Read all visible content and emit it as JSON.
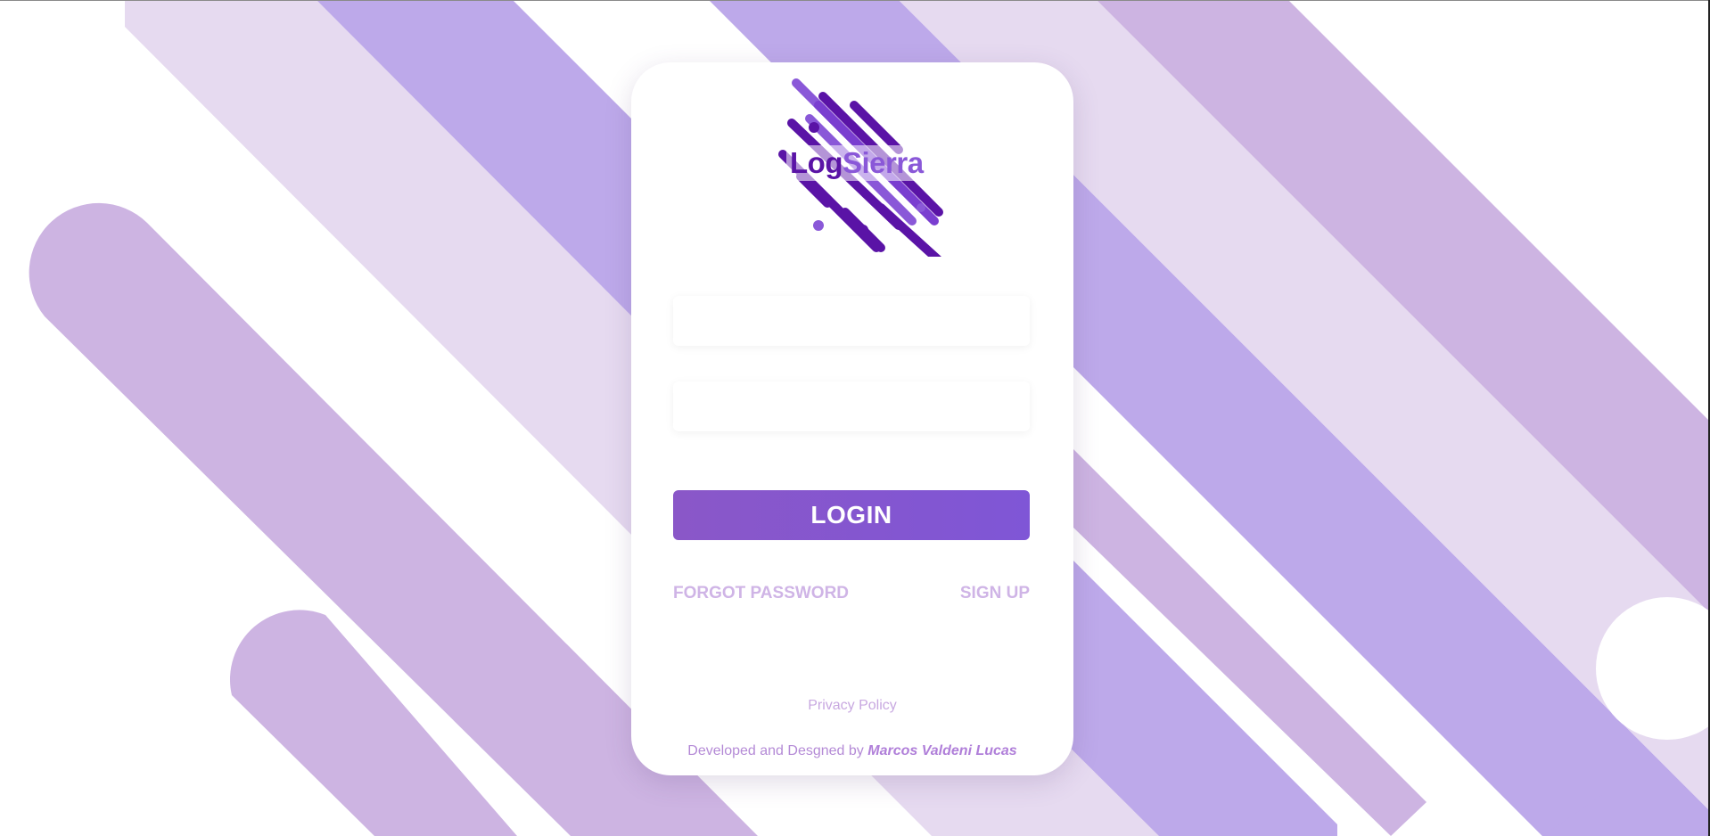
{
  "app": {
    "brand_part1": "Log",
    "brand_part2": "Sierra"
  },
  "form": {
    "username_value": "",
    "password_value": "",
    "login_label": "LOGIN"
  },
  "links": {
    "forgot_password": "FORGOT PASSWORD",
    "sign_up": "SIGN UP",
    "privacy_policy": "Privacy Policy"
  },
  "footer": {
    "credit_prefix": "Developed and Desgned by",
    "credit_author": "Marcos Valdeni Lucas"
  },
  "colors": {
    "stripe_lavender_light": "#e6daf0",
    "stripe_violet": "#bda9ea",
    "stripe_mauve": "#cdb4e2",
    "brand_dark": "#5a13a6",
    "brand_light": "#8a58d8",
    "button": "#8456cf",
    "link": "#cfb4e6"
  },
  "icons": {
    "logo": "logsierra-logo"
  }
}
